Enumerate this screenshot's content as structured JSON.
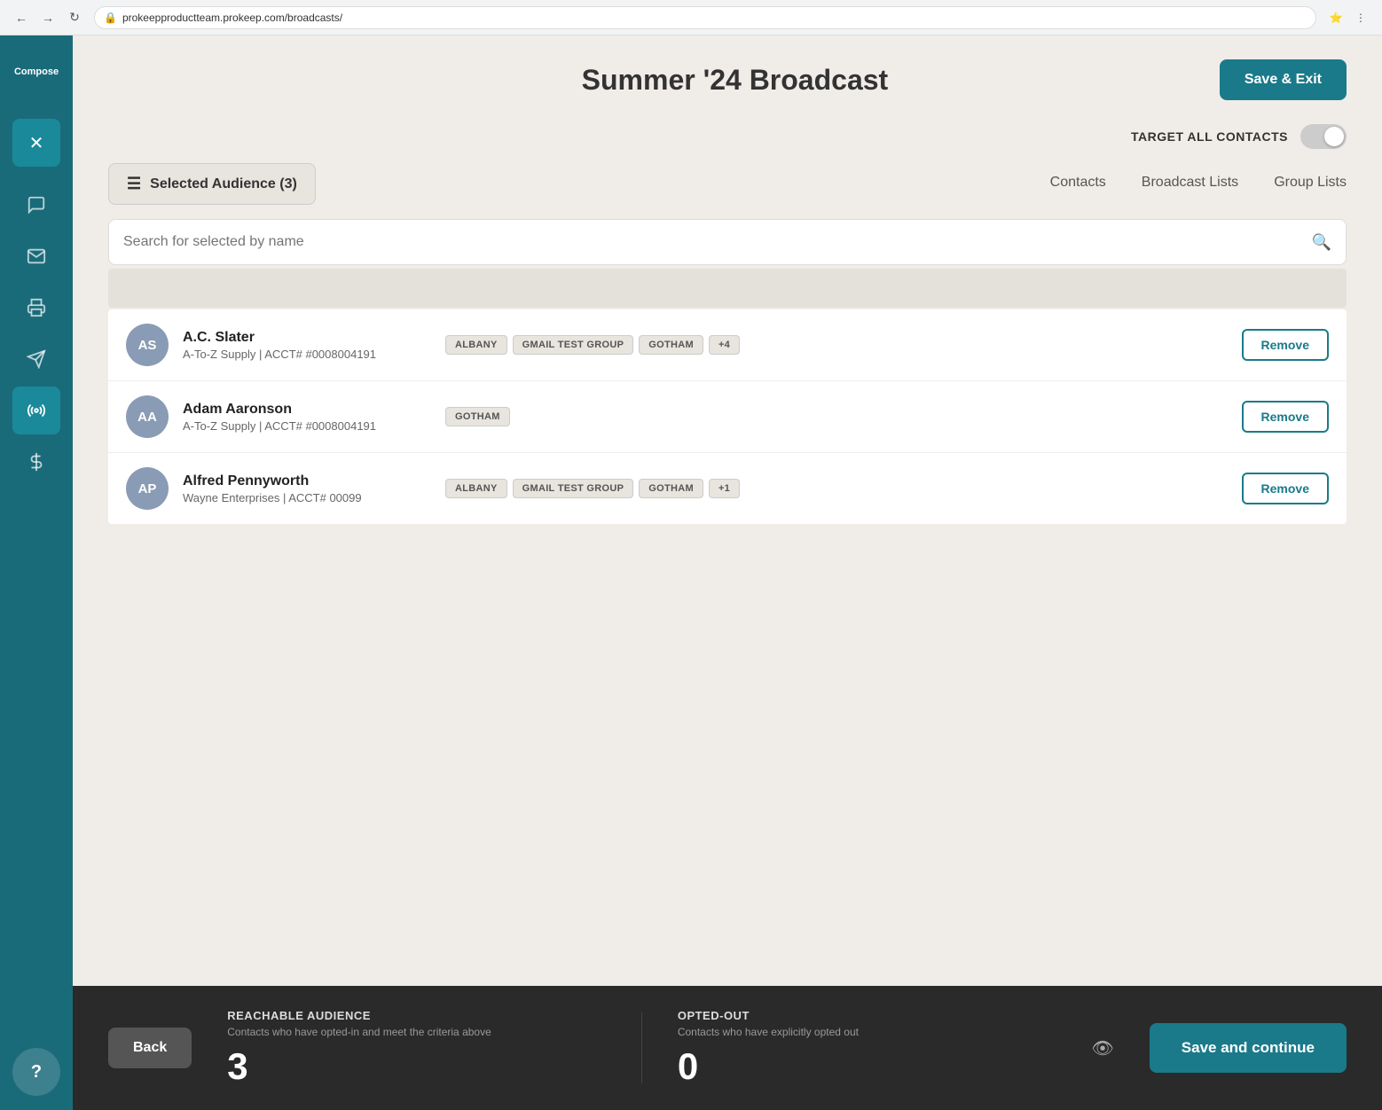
{
  "browser": {
    "url": "prokeepproductteam.prokeep.com/broadcasts/"
  },
  "header": {
    "title": "Summer '24 Broadcast",
    "save_exit_label": "Save & Exit"
  },
  "target_all": {
    "label": "TARGET ALL CONTACTS"
  },
  "audience": {
    "selected_label": "Selected Audience (3)",
    "tabs": [
      {
        "label": "Contacts"
      },
      {
        "label": "Broadcast Lists"
      },
      {
        "label": "Group Lists"
      }
    ]
  },
  "search": {
    "placeholder": "Search for selected by name"
  },
  "contacts": [
    {
      "initials": "AS",
      "name": "A.C. Slater",
      "company": "A-To-Z Supply | ACCT# #0008004191",
      "tags": [
        "ALBANY",
        "GMAIL TEST GROUP",
        "GOTHAM",
        "+4"
      ],
      "remove_label": "Remove"
    },
    {
      "initials": "AA",
      "name": "Adam Aaronson",
      "company": "A-To-Z Supply | ACCT# #0008004191",
      "tags": [
        "GOTHAM"
      ],
      "remove_label": "Remove"
    },
    {
      "initials": "AP",
      "name": "Alfred Pennyworth",
      "company": "Wayne Enterprises | ACCT# 00099",
      "tags": [
        "ALBANY",
        "GMAIL TEST GROUP",
        "GOTHAM",
        "+1"
      ],
      "remove_label": "Remove"
    }
  ],
  "footer": {
    "back_label": "Back",
    "reachable": {
      "title": "REACHABLE AUDIENCE",
      "desc": "Contacts who have opted-in and meet the criteria above",
      "value": "3"
    },
    "opted_out": {
      "title": "OPTED-OUT",
      "desc": "Contacts who have explicitly opted out",
      "value": "0"
    },
    "save_continue_label": "Save and continue"
  },
  "sidebar": {
    "items": [
      {
        "icon": "✕",
        "name": "close"
      },
      {
        "icon": "💬",
        "name": "chat"
      },
      {
        "icon": "✉",
        "name": "email"
      },
      {
        "icon": "🖨",
        "name": "print"
      },
      {
        "icon": "➤",
        "name": "send"
      },
      {
        "icon": "📡",
        "name": "broadcast"
      },
      {
        "icon": "$",
        "name": "billing"
      }
    ],
    "help_label": "?"
  }
}
